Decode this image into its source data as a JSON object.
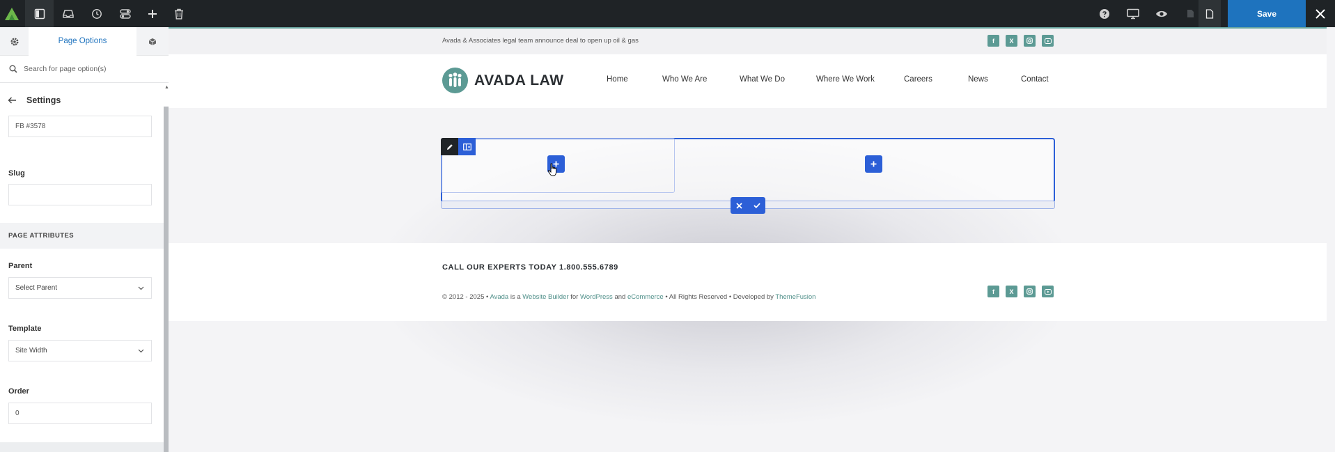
{
  "toolbar": {
    "save_label": "Save",
    "accent": "#1e73be"
  },
  "sidebar": {
    "tab_label": "Page Options",
    "search_placeholder": "Search for page option(s)",
    "section_title": "Settings",
    "title_value": "FB #3578",
    "slug_label": "Slug",
    "slug_value": "",
    "attributes_heading": "PAGE ATTRIBUTES",
    "parent_label": "Parent",
    "parent_value": "Select Parent",
    "template_label": "Template",
    "template_value": "Site Width",
    "order_label": "Order",
    "order_value": "0"
  },
  "site": {
    "announcement": "Avada & Associates legal team announce deal to open up oil & gas",
    "brand": "AVADA LAW",
    "brand_color": "#5c9a94",
    "nav": [
      "Home",
      "Who We Are",
      "What We Do",
      "Where We Work",
      "Careers",
      "News",
      "Contact"
    ],
    "social": [
      "facebook-icon",
      "x-icon",
      "instagram-icon",
      "youtube-icon"
    ],
    "footer_cta": "CALL OUR EXPERTS TODAY 1.800.555.6789",
    "copyright": {
      "prefix": "© 2012 - 2025 • ",
      "avada": "Avada",
      "is_a": " is a ",
      "website_builder": "Website Builder",
      "for": " for ",
      "wordpress": "WordPress",
      "and": " and ",
      "ecommerce": "eCommerce",
      "rights": " • All Rights Reserved • Developed by ",
      "themefusion": "ThemeFusion"
    }
  },
  "builder": {
    "accent": "#2c5fd7"
  }
}
